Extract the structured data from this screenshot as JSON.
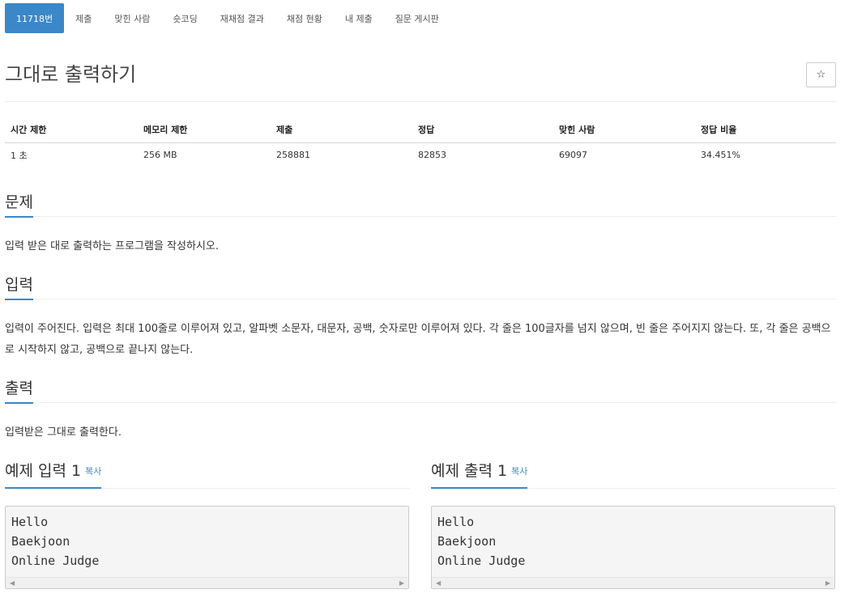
{
  "tabs": [
    {
      "label": "11718번"
    },
    {
      "label": "제출"
    },
    {
      "label": "맞힌 사람"
    },
    {
      "label": "숏코딩"
    },
    {
      "label": "재채점 결과"
    },
    {
      "label": "채점 현황"
    },
    {
      "label": "내 제출"
    },
    {
      "label": "질문 게시판"
    }
  ],
  "problem": {
    "title": "그대로 출력하기",
    "star_icon": "☆"
  },
  "info": {
    "headers": [
      "시간 제한",
      "메모리 제한",
      "제출",
      "정답",
      "맞힌 사람",
      "정답 비율"
    ],
    "values": [
      "1 초",
      "256 MB",
      "258881",
      "82853",
      "69097",
      "34.451%"
    ]
  },
  "sections": {
    "problem": {
      "heading": "문제",
      "body": "입력 받은 대로 출력하는 프로그램을 작성하시오."
    },
    "input": {
      "heading": "입력",
      "body": "입력이 주어진다. 입력은 최대 100줄로 이루어져 있고, 알파벳 소문자, 대문자, 공백, 숫자로만 이루어져 있다. 각 줄은 100글자를 넘지 않으며, 빈 줄은 주어지지 않는다. 또, 각 줄은 공백으로 시작하지 않고, 공백으로 끝나지 않는다."
    },
    "output": {
      "heading": "출력",
      "body": "입력받은 그대로 출력한다."
    }
  },
  "samples": {
    "input": {
      "heading": "예제 입력 1",
      "copy_label": "복사",
      "content": "Hello\nBaekjoon\nOnline Judge"
    },
    "output": {
      "heading": "예제 출력 1",
      "copy_label": "복사",
      "content": "Hello\nBaekjoon\nOnline Judge"
    }
  },
  "colors": {
    "accent": "#3b87c8",
    "text": "#333333",
    "pre_background": "#f5f5f5"
  }
}
